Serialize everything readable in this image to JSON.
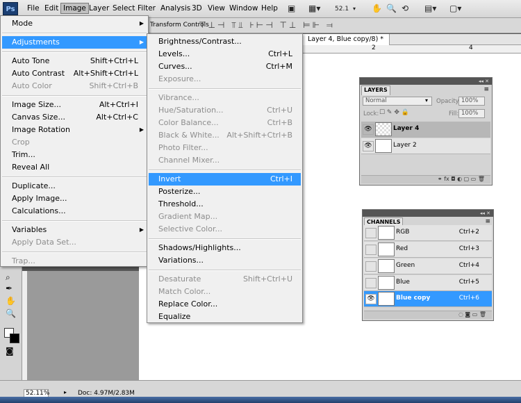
{
  "menubar": {
    "logo": "Ps",
    "items": [
      "File",
      "Edit",
      "Image",
      "Layer",
      "Select",
      "Filter",
      "Analysis",
      "3D",
      "View",
      "Window",
      "Help"
    ],
    "zoom": "52.1"
  },
  "options_bar": {
    "transform_label": "Transform Controls"
  },
  "document": {
    "tab_title": "Layer 4, Blue copy/8) *"
  },
  "ruler": {
    "ticks": [
      "2",
      "4"
    ]
  },
  "status": {
    "zoom": "52.11%",
    "doc_info": "Doc: 4.97M/2.83M"
  },
  "image_menu": [
    {
      "label": "Mode",
      "submenu": true
    },
    {
      "sep": true
    },
    {
      "label": "Adjustments",
      "submenu": true,
      "highlight": true
    },
    {
      "sep": true
    },
    {
      "label": "Auto Tone",
      "shortcut": "Shift+Ctrl+L"
    },
    {
      "label": "Auto Contrast",
      "shortcut": "Alt+Shift+Ctrl+L"
    },
    {
      "label": "Auto Color",
      "shortcut": "Shift+Ctrl+B",
      "disabled": true
    },
    {
      "sep": true
    },
    {
      "label": "Image Size...",
      "shortcut": "Alt+Ctrl+I"
    },
    {
      "label": "Canvas Size...",
      "shortcut": "Alt+Ctrl+C"
    },
    {
      "label": "Image Rotation",
      "submenu": true
    },
    {
      "label": "Crop",
      "disabled": true
    },
    {
      "label": "Trim..."
    },
    {
      "label": "Reveal All"
    },
    {
      "sep": true
    },
    {
      "label": "Duplicate..."
    },
    {
      "label": "Apply Image..."
    },
    {
      "label": "Calculations..."
    },
    {
      "sep": true
    },
    {
      "label": "Variables",
      "submenu": true
    },
    {
      "label": "Apply Data Set...",
      "disabled": true
    },
    {
      "sep": true
    },
    {
      "label": "Trap...",
      "disabled": true
    }
  ],
  "adjustments_menu": [
    {
      "label": "Brightness/Contrast..."
    },
    {
      "label": "Levels...",
      "shortcut": "Ctrl+L"
    },
    {
      "label": "Curves...",
      "shortcut": "Ctrl+M"
    },
    {
      "label": "Exposure...",
      "disabled": true
    },
    {
      "sep": true
    },
    {
      "label": "Vibrance...",
      "disabled": true
    },
    {
      "label": "Hue/Saturation...",
      "shortcut": "Ctrl+U",
      "disabled": true
    },
    {
      "label": "Color Balance...",
      "shortcut": "Ctrl+B",
      "disabled": true
    },
    {
      "label": "Black & White...",
      "shortcut": "Alt+Shift+Ctrl+B",
      "disabled": true
    },
    {
      "label": "Photo Filter...",
      "disabled": true
    },
    {
      "label": "Channel Mixer...",
      "disabled": true
    },
    {
      "sep": true
    },
    {
      "label": "Invert",
      "shortcut": "Ctrl+I",
      "highlight": true
    },
    {
      "label": "Posterize..."
    },
    {
      "label": "Threshold..."
    },
    {
      "label": "Gradient Map...",
      "disabled": true
    },
    {
      "label": "Selective Color...",
      "disabled": true
    },
    {
      "sep": true
    },
    {
      "label": "Shadows/Highlights..."
    },
    {
      "label": "Variations..."
    },
    {
      "sep": true
    },
    {
      "label": "Desaturate",
      "shortcut": "Shift+Ctrl+U",
      "disabled": true
    },
    {
      "label": "Match Color...",
      "disabled": true
    },
    {
      "label": "Replace Color..."
    },
    {
      "label": "Equalize"
    }
  ],
  "layers_panel": {
    "tab": "LAYERS",
    "blend_mode": "Normal",
    "opacity_label": "Opacity:",
    "opacity": "100%",
    "lock_label": "Lock:",
    "fill_label": "Fill:",
    "fill": "100%",
    "layers": [
      {
        "name": "Layer 4",
        "selected": true
      },
      {
        "name": "Layer 2"
      }
    ]
  },
  "channels_panel": {
    "tab": "CHANNELS",
    "channels": [
      {
        "name": "RGB",
        "shortcut": "Ctrl+2"
      },
      {
        "name": "Red",
        "shortcut": "Ctrl+3"
      },
      {
        "name": "Green",
        "shortcut": "Ctrl+4"
      },
      {
        "name": "Blue",
        "shortcut": "Ctrl+5"
      },
      {
        "name": "Blue copy",
        "shortcut": "Ctrl+6",
        "selected": true
      }
    ]
  },
  "colors": {
    "highlight": "#3399ff",
    "menu_bg": "#f0f0f0",
    "panel_bg": "#d4d4d4"
  }
}
